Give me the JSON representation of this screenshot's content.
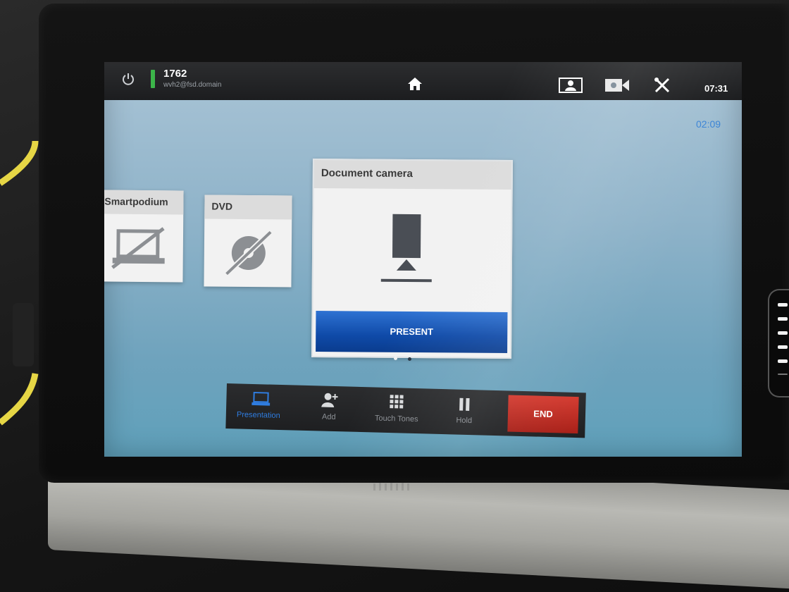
{
  "status": {
    "call_id": "1762",
    "call_uri": "wvh2@fsd.domain",
    "time": "07:31",
    "call_duration": "02:09"
  },
  "sources": [
    {
      "label": "Smartpodium",
      "icon": "laptop-disabled-icon"
    },
    {
      "label": "DVD",
      "icon": "disc-disabled-icon"
    },
    {
      "label": "Document camera",
      "icon": "document-camera-icon",
      "action_label": "PRESENT"
    }
  ],
  "pager": {
    "pages": 2,
    "current": 1
  },
  "controls": [
    {
      "label": "Presentation",
      "icon": "presentation-icon"
    },
    {
      "label": "Add",
      "icon": "add-participant-icon"
    },
    {
      "label": "Touch Tones",
      "icon": "keypad-icon"
    },
    {
      "label": "Hold",
      "icon": "pause-icon"
    }
  ],
  "end_label": "END",
  "colors": {
    "accent_blue": "#0f4aa8",
    "end_red": "#c0281f",
    "status_green": "#3cb54a",
    "timer_blue": "#3a84d6"
  }
}
